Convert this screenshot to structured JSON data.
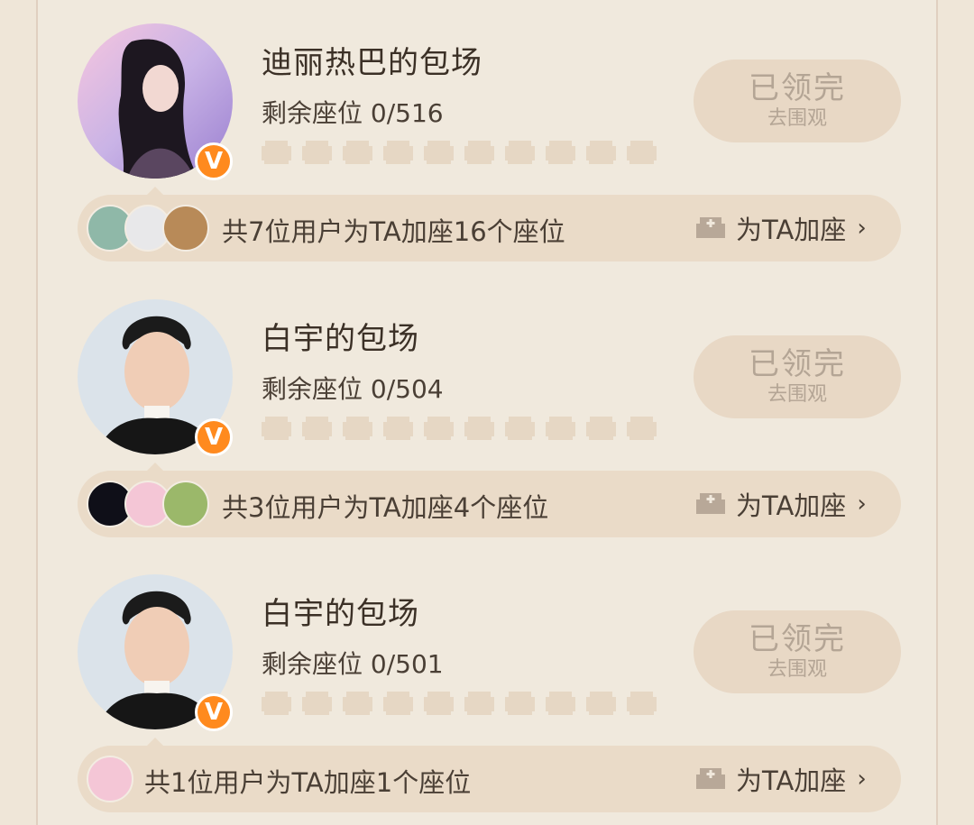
{
  "cards": [
    {
      "title": "迪丽热巴的包场",
      "seats_text": "剩余座位 0/516",
      "claim_main": "已领完",
      "claim_sub": "去围观",
      "boost_text": "共7位用户为TA加座16个座位",
      "boost_action": "为TA加座",
      "badge": "V"
    },
    {
      "title": "白宇的包场",
      "seats_text": "剩余座位 0/504",
      "claim_main": "已领完",
      "claim_sub": "去围观",
      "boost_text": "共3位用户为TA加座4个座位",
      "boost_action": "为TA加座",
      "badge": "V"
    },
    {
      "title": "白宇的包场",
      "seats_text": "剩余座位 0/501",
      "claim_main": "已领完",
      "claim_sub": "去围观",
      "boost_text": "共1位用户为TA加座1个座位",
      "boost_action": "为TA加座",
      "badge": "V"
    }
  ],
  "icons": {
    "verified": "verified-v-icon",
    "seat": "seat-sofa-icon",
    "add_seat": "sofa-plus-icon",
    "chevron": "chevron-right-icon"
  },
  "colors": {
    "background": "#efe6d8",
    "button": "#e8d8c5",
    "badge": "#ff8a1e"
  }
}
